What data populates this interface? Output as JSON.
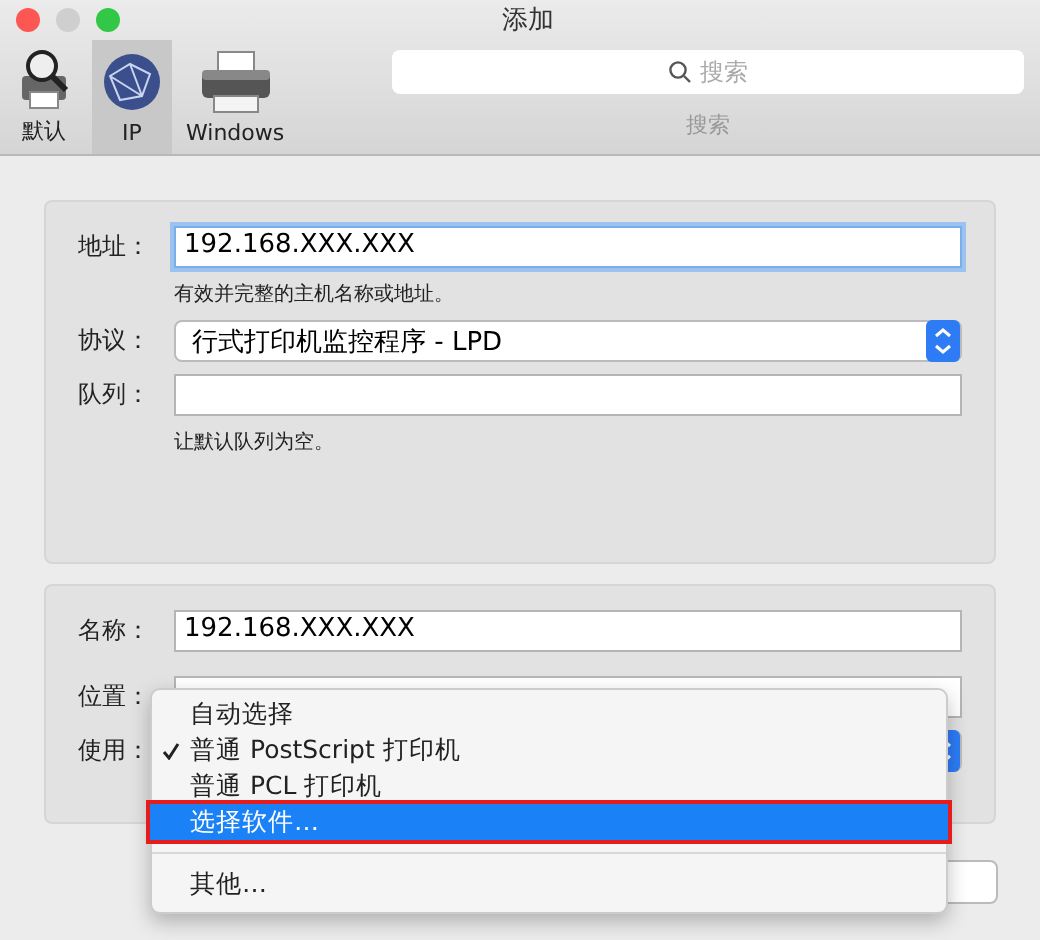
{
  "window": {
    "title": "添加"
  },
  "toolbar": {
    "tabs": [
      {
        "label": "默认",
        "kind": "default",
        "selected": false
      },
      {
        "label": "IP",
        "kind": "ip",
        "selected": true
      },
      {
        "label": "Windows",
        "kind": "windows",
        "selected": false
      }
    ],
    "search": {
      "placeholder": "搜索",
      "label": "搜索"
    }
  },
  "connection": {
    "address": {
      "label": "地址：",
      "value": "192.168.XXX.XXX",
      "hint": "有效并完整的主机名称或地址。"
    },
    "protocol": {
      "label": "协议：",
      "value": "行式打印机监控程序 - LPD"
    },
    "queue": {
      "label": "队列：",
      "hint": "让默认队列为空。"
    }
  },
  "printer": {
    "name": {
      "label": "名称：",
      "value": "192.168.XXX.XXX"
    },
    "location": {
      "label": "位置："
    },
    "use": {
      "label": "使用："
    }
  },
  "use_menu": {
    "items": [
      {
        "label": "自动选择",
        "checked": false,
        "selected": false,
        "highlighted": false
      },
      {
        "label": "普通 PostScript 打印机",
        "checked": true,
        "selected": false,
        "highlighted": false
      },
      {
        "label": "普通 PCL 打印机",
        "checked": false,
        "selected": false,
        "highlighted": false
      },
      {
        "label": "选择软件…",
        "checked": false,
        "selected": true,
        "highlighted": true
      },
      {
        "kind": "separator"
      },
      {
        "label": "其他…",
        "checked": false,
        "selected": false,
        "highlighted": false
      }
    ]
  }
}
